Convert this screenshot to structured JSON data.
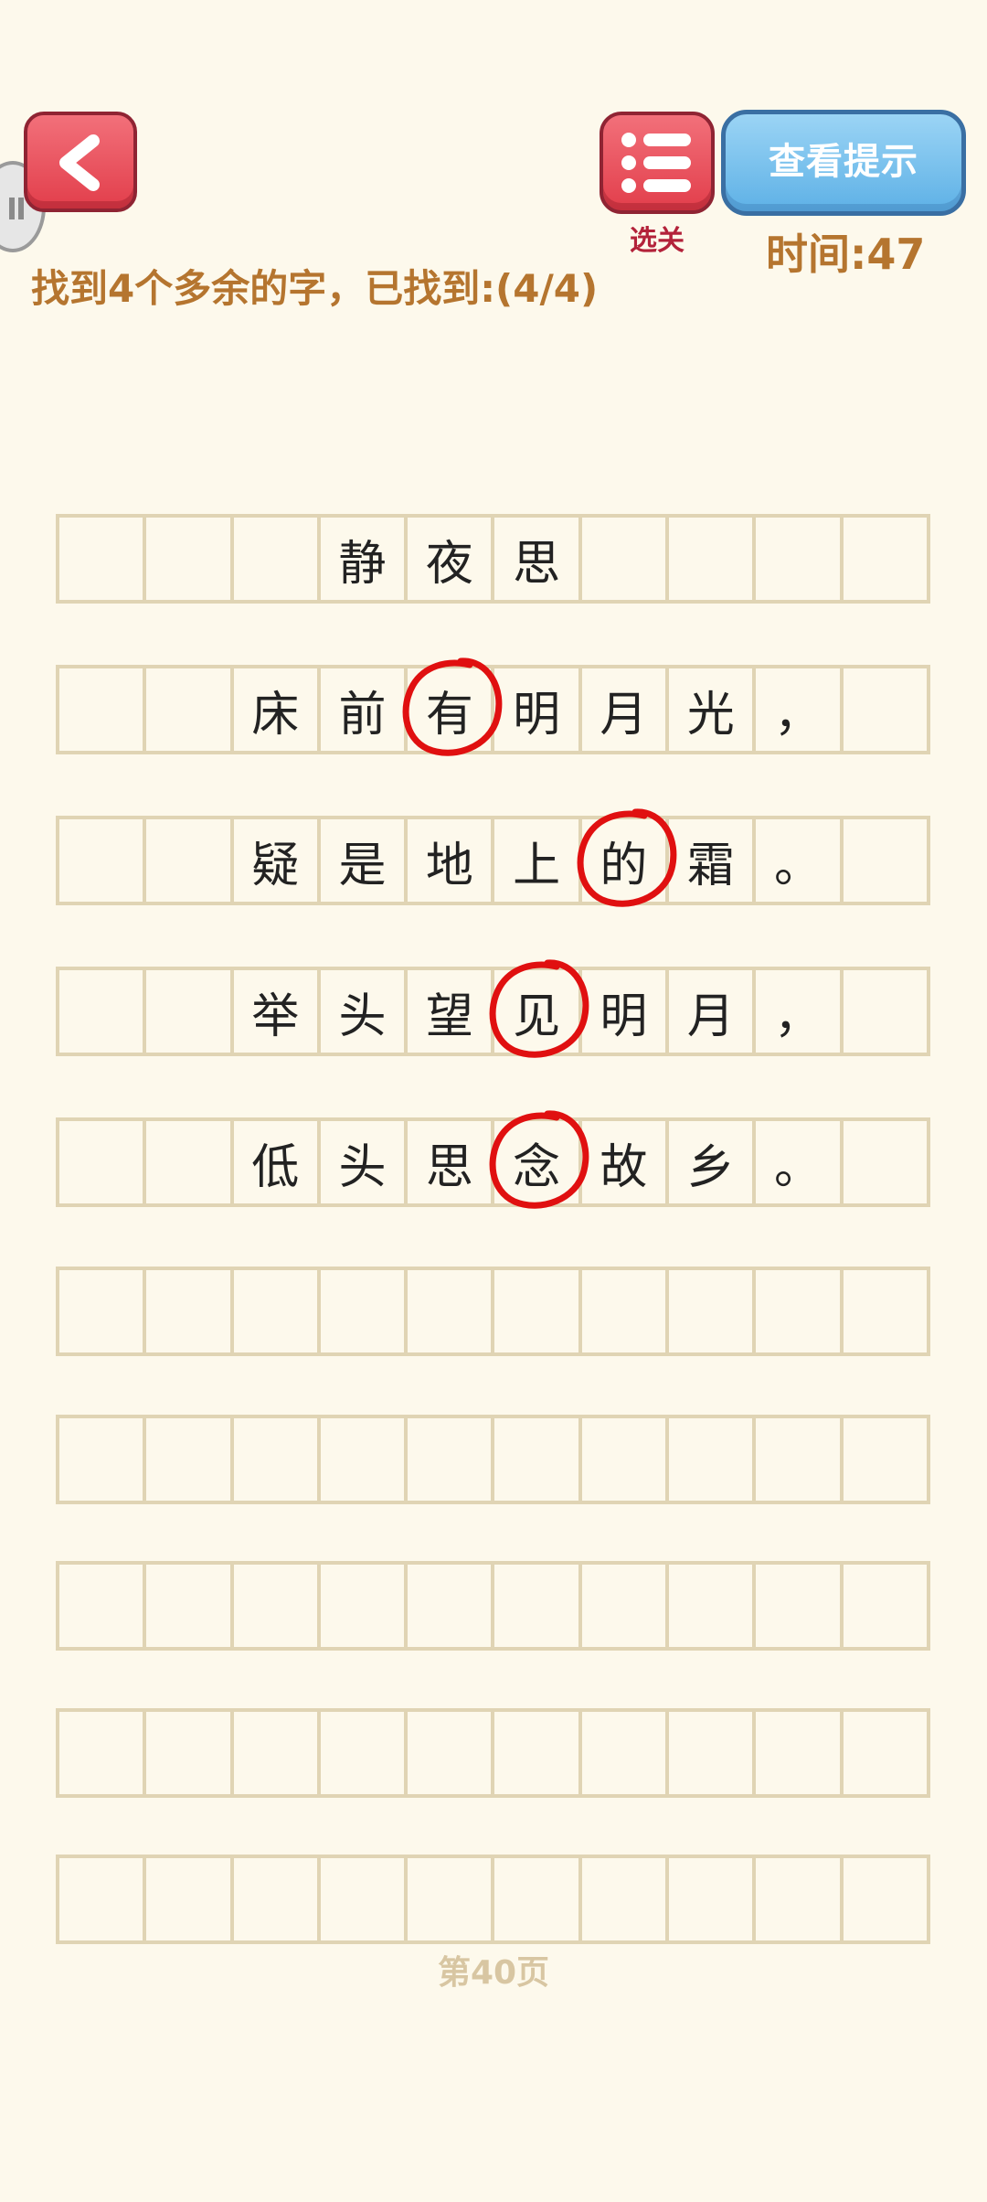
{
  "header": {
    "menu_label": "选关",
    "hint_label": "查看提示",
    "timer": "时间:47",
    "instruction": "找到4个多余的字，已找到:(4/4)"
  },
  "puzzle": {
    "rows": [
      [
        "",
        "",
        "",
        "静",
        "夜",
        "思",
        "",
        "",
        "",
        ""
      ],
      [
        "",
        "",
        "床",
        "前",
        "有",
        "明",
        "月",
        "光",
        "，",
        ""
      ],
      [
        "",
        "",
        "疑",
        "是",
        "地",
        "上",
        "的",
        "霜",
        "。",
        ""
      ],
      [
        "",
        "",
        "举",
        "头",
        "望",
        "见",
        "明",
        "月",
        "，",
        ""
      ],
      [
        "",
        "",
        "低",
        "头",
        "思",
        "念",
        "故",
        "乡",
        "。",
        ""
      ],
      [
        "",
        "",
        "",
        "",
        "",
        "",
        "",
        "",
        "",
        ""
      ],
      [
        "",
        "",
        "",
        "",
        "",
        "",
        "",
        "",
        "",
        ""
      ],
      [
        "",
        "",
        "",
        "",
        "",
        "",
        "",
        "",
        "",
        ""
      ],
      [
        "",
        "",
        "",
        "",
        "",
        "",
        "",
        "",
        "",
        ""
      ],
      [
        "",
        "",
        "",
        "",
        "",
        "",
        "",
        "",
        "",
        ""
      ]
    ],
    "found": [
      {
        "row": 1,
        "col": 4
      },
      {
        "row": 2,
        "col": 6
      },
      {
        "row": 3,
        "col": 5
      },
      {
        "row": 4,
        "col": 5
      }
    ],
    "circle_color": "#e01010"
  },
  "footer": {
    "page": "第40页"
  },
  "icons": {
    "back": "chevron-left-icon",
    "menu": "list-icon"
  }
}
